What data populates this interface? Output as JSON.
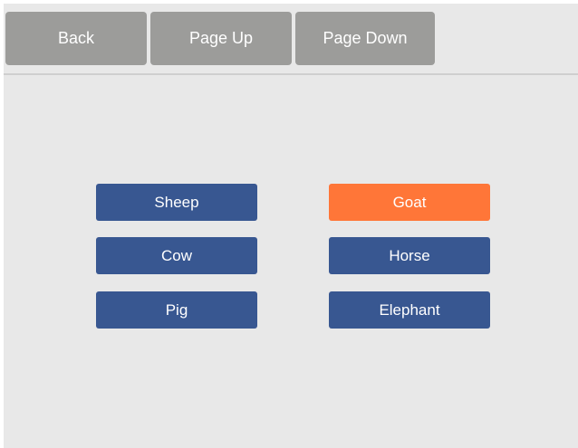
{
  "toolbar": {
    "back_label": "Back",
    "page_up_label": "Page Up",
    "page_down_label": "Page Down"
  },
  "choices": {
    "left": [
      "Sheep",
      "Cow",
      "Pig"
    ],
    "right": [
      "Goat",
      "Horse",
      "Elephant"
    ],
    "selected": "Goat"
  },
  "colors": {
    "toolbar_button": "#9c9c9a",
    "choice_button": "#385791",
    "selected_choice": "#ff7638",
    "background": "#e8e8e8"
  }
}
